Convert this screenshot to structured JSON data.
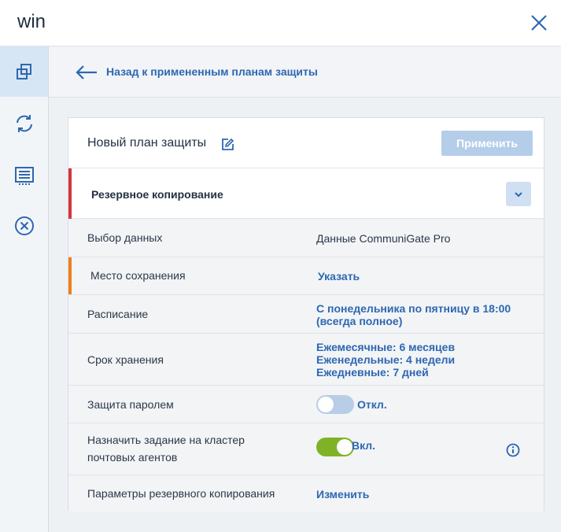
{
  "window": {
    "title": "win",
    "close_icon": "close-icon"
  },
  "leftnav": {
    "items": [
      {
        "icon": "plans-icon",
        "active": true
      },
      {
        "icon": "sync-icon",
        "active": false
      },
      {
        "icon": "activity-icon",
        "active": false
      },
      {
        "icon": "revoke-icon",
        "active": false
      }
    ]
  },
  "back": {
    "label": "Назад к примененным планам защиты"
  },
  "plan": {
    "title": "Новый план защиты",
    "apply_label": "Применить"
  },
  "section": {
    "label": "Резервное копирование",
    "marker_color": "#d3363a"
  },
  "rows": {
    "data_select": {
      "label": "Выбор данных",
      "value": "Данные CommuniGate Pro"
    },
    "destination": {
      "label": "Место сохранения",
      "value": "Указать",
      "marker_color": "#ef7f1a"
    },
    "schedule": {
      "label": "Расписание",
      "value_line1": "С понедельника по пятницу в 18:00",
      "value_line2": "(всегда полное)"
    },
    "retention": {
      "label": "Срок хранения",
      "line1": "Ежемесячные: 6 месяцев",
      "line2": "Еженедельные: 4 недели",
      "line3": "Ежедневные: 7 дней"
    },
    "password": {
      "label": "Защита паролем",
      "state": "Откл.",
      "enabled": false
    },
    "cluster": {
      "label_line1": "Назначить задание на кластер",
      "label_line2": "почтовых агентов",
      "state": "Вкл.",
      "enabled": true
    },
    "options": {
      "label": "Параметры резервного копирования",
      "value": "Изменить"
    }
  },
  "colors": {
    "accent": "#2e67b1",
    "apply_disabled": "#b4cde9",
    "switch_on": "#7fb227",
    "switch_off": "#b8cde6"
  }
}
